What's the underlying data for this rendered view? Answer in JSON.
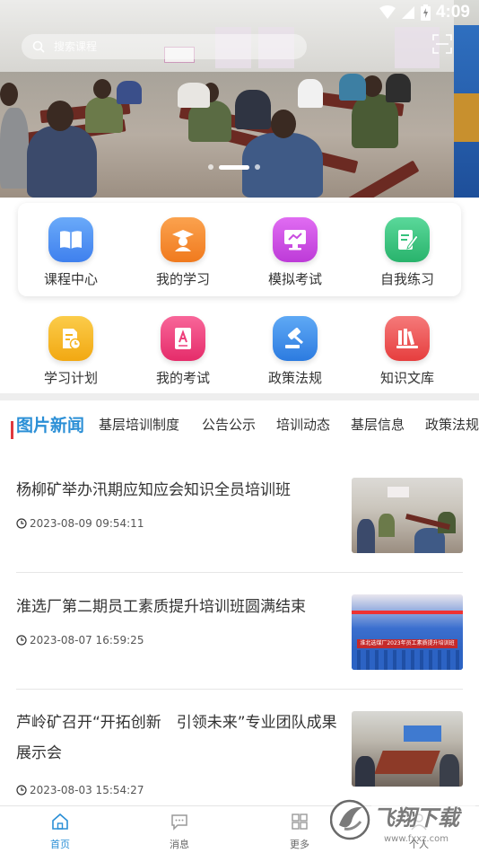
{
  "status": {
    "time": "4:09"
  },
  "search": {
    "placeholder": "搜索课程"
  },
  "menu": [
    {
      "label": "课程中心",
      "icon": "book-icon",
      "color": "#4a8ff2"
    },
    {
      "label": "我的学习",
      "icon": "graduate-icon",
      "color": "#f58a2e"
    },
    {
      "label": "模拟考试",
      "icon": "monitor-icon",
      "color": "#c94ce0"
    },
    {
      "label": "自我练习",
      "icon": "note-edit-icon",
      "color": "#35c27c"
    },
    {
      "label": "学习计划",
      "icon": "schedule-icon",
      "color": "#f5b41f"
    },
    {
      "label": "我的考试",
      "icon": "exam-paper-icon",
      "color": "#ee3f7a"
    },
    {
      "label": "政策法规",
      "icon": "gavel-icon",
      "color": "#3d8fea"
    },
    {
      "label": "知识文库",
      "icon": "library-icon",
      "color": "#ef5555"
    }
  ],
  "tabs": [
    "图片新闻",
    "基层培训制度",
    "公告公示",
    "培训动态",
    "基层信息",
    "政策法规"
  ],
  "news": [
    {
      "title": "杨柳矿举办汛期应知应会知识全员培训班",
      "time": "2023-08-09 09:54:11"
    },
    {
      "title": "淮选厂第二期员工素质提升培训班圆满结束",
      "time": "2023-08-07 16:59:25",
      "thumb_banner": "淮北选煤厂2023年员工素质提升培训班"
    },
    {
      "title": "芦岭矿召开“开拓创新　引领未来”专业团队成果展示会",
      "time": "2023-08-03 15:54:27"
    }
  ],
  "nav": [
    {
      "label": "首页",
      "icon": "home-icon"
    },
    {
      "label": "消息",
      "icon": "message-icon"
    },
    {
      "label": "更多",
      "icon": "grid-icon"
    },
    {
      "label": "个人",
      "icon": "person-icon"
    }
  ],
  "watermark": {
    "text": "飞翔下载",
    "url": "www.fxxz.com"
  },
  "colors": {
    "accent": "#2b8fd6",
    "tab_indicator": "#e0383e"
  }
}
